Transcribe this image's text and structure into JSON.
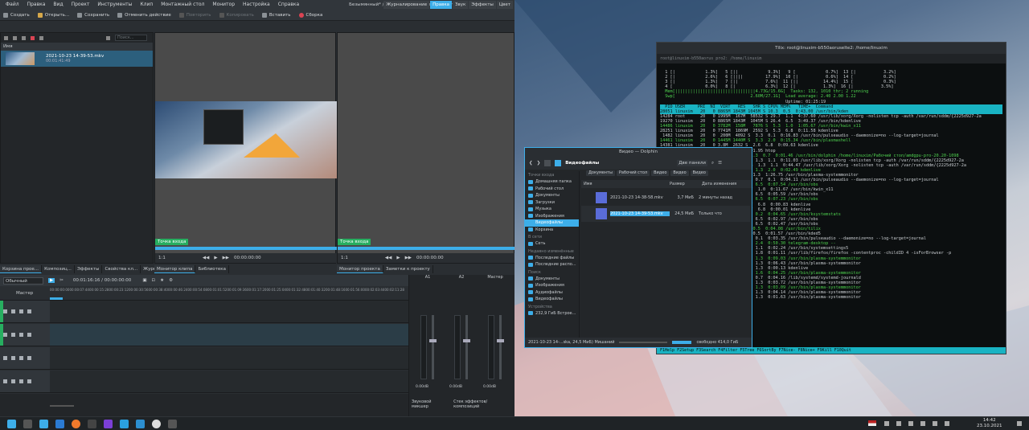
{
  "kdenlive": {
    "menu": [
      "Файл",
      "Правка",
      "Вид",
      "Проект",
      "Инструменты",
      "Клип",
      "Монтажный стол",
      "Монитор",
      "Настройка",
      "Справка"
    ],
    "title": "Безымянный* / 3440x1440 60.00fps — Kdenlive",
    "ws_tabs": [
      "Журналирование",
      "Правка",
      "Звук",
      "Эффекты",
      "Цвет"
    ],
    "toolbar": {
      "new": "Создать",
      "open": "Открыть...",
      "save": "Сохранить",
      "undo": "Отменить действие",
      "redo": "Повторить",
      "copy": "Копировать",
      "paste": "Вставить",
      "render": "Сборка"
    },
    "bin": {
      "column": "Имя",
      "search_placeholder": "Поиск...",
      "clip_name": "2021-10-23 14-39-53.mkv",
      "clip_dur": "00:01:41:49"
    },
    "dock_tabs_left": [
      "Корзина прое...",
      "Композиц...",
      "Эффекты",
      "Свойства кл...",
      "Журнал дейст..."
    ],
    "dock_tabs_clip": [
      "Монитор клипа",
      "Библиотека"
    ],
    "dock_tabs_proj": [
      "Монитор проекта",
      "Заметки к проекту"
    ],
    "clip_monitor": {
      "label": "Точка входа",
      "zoom": "1:1",
      "timecode": "00:00:00:00",
      "in_time": "00:00:00"
    },
    "proj_monitor": {
      "label": "Точка входа",
      "zoom": "1:1",
      "timecode": "00:00:00:00"
    },
    "timeline": {
      "mode": "Обычный режим",
      "timecode": "00:01:16:16 / 00:00:00:00",
      "master": "Мастер",
      "ruler": [
        "00:00:00:00",
        "00:00:07:44",
        "00:00:15:28",
        "00:00:23:12",
        "00:00:30:56",
        "00:00:38:40",
        "00:00:46:24",
        "00:00:54:08",
        "00:01:01:52",
        "00:01:09:36",
        "00:01:17:20",
        "00:01:25:04",
        "00:01:32:48",
        "00:01:40:32",
        "00:01:48:16",
        "00:01:56:00",
        "00:02:03:44",
        "00:02:11:28"
      ],
      "tracks": [
        "V2",
        "V1",
        "A1",
        "A2"
      ]
    },
    "mixer": {
      "channels": [
        "A1",
        "A2",
        "Мастер"
      ],
      "db": "0.00dB",
      "tabs": [
        "Звуковой микшер",
        "Стек эффектов/композиций"
      ]
    }
  },
  "konsole": {
    "title": "Tilix: root@linuxim-b550aorusel​te2: /home/linuxim",
    "tab": "root@linuxim-b550aorus pro2: /home/linuxim",
    "header": "  PID USER     PRI  NI  VIRT   RES   SHR S CPU% MEM%   TIME+  Command",
    "cpu_lines": [
      "  1 [|            1.3%]   5 [||            9.3%]   9 [            0.7%]  13 [|           3.2%]",
      "  2 [|            2.6%]   6 [||||         17.9%]  10 [|           0.6%]  14 [            0.2%]",
      "  3 [|            1.3%]   7 [||           7.6%]  11 [||          14.4%]  15 [            0.3%]",
      "  4 [             0.0%]   8 [|            6.3%]  12 [|           1.3%]  16 [|           3.5%]",
      "  Mem[||||||||||||||||||||||||||||||||4.73G/15.6G]  Tasks: 132, 1010 thr; 2 running",
      "  Swp[                              2.60M/27.1G]  Load average: 2.40 2.00 1.22",
      "                                                  Uptime: 01:25:19"
    ],
    "procs": [
      "28051 linuxim   20   0 8865M 1843M 1045M S 10.3  0.5  0:43.00 /usr/bin/kden",
      "14284 root      20   0 1995M  167M  58532 S 29.7  1.1  4:37.60 /usr/lib/xorg/Xorg -nolisten tcp -auth /var/run/sddm/{2225d927-2a",
      "19270 linuxim   20   0 8865M 1843M  1045M S 26.4  6.5  3:49.37 /usr/bin/kdenlive",
      "14486 linuxim   20   0 3782M  158M   7876 S  5.3  1.0  1:05.67 /usr/bin/kwin_x11",
      "28251 linuxim   20   0 7741M  1869M  2592 S  5.3  6.8  0:11.58 kdenlive",
      " 1482 linuxim   20   0  200M  4092 S  3.3  0.1  0:16.83 /usr/bin/pulseaudio --daemonize=no --log-target=journal",
      "14461 linuxim   20   0 1445M 1440M S  3.3  2.0  0:15.34 /usr/bin/plasmashell",
      "14381 linuxim   20   0 3.8M  2632 S  2.6  6.8  0:09.63 kdenlive",
      "14363 linuxim   20   0 104M  2.8  0:01.95 htop",
      "12833 linuxim   20   0 1.3M 2828 S  1.3  0.7  0:01.46 /usr/bin/dolphin /home/linuxim/Рабочий стол/amdgpu-pro-20.20-1098",
      "14281 root      20   0  140M  8532 S  1.3  1.1  0:11.03 /usr/lib/xorg/Xorg -nolisten tcp -auth /var/run/sddm/{2225d927-2a",
      "14467 root      20   0  1955M  8532 S  1.3  1.1  0:44.47 /usr/lib/xorg/Xorg -nolisten tcp -auth /var/run/sddm/{2225d927-2a",
      "14470 linuxim   20   0  148M  4092 S  1.3  2.0  0:02.49 kdenlive",
      "14352 linuxim   20   0  1.3M  5 0.7  1.3  1:26.75 /usr/bin/plasma-systemmonitor",
      "14353 linuxim   20   0  200M  4092 S  0.7  0.1  0:04.11 /usr/bin/pulseaudio --daemonize=no --log-target=journal",
      "14318 linuxim   20   0  128M  S  0.7  6.5  0:07.54 /usr/bin/obs",
      "14313 linuxim   20   0  3782M  S  0.7  1.0  0:11.67 /usr/bin/kwin_x11",
      "14317 linuxim   20   0  153M  S  0.7  6.5  0:05.59 /usr/bin/obs",
      "14339 linuxim   20   0  153M  S  0.7  6.5  0:07.23 /usr/bin/obs",
      "14386 linuxim   20   0  7741M  S  0.7  6.8  0:00.83 kdenlive",
      "14396 linuxim   20   0  7741M  S  0.7  6.8  0:00.01 kdenlive",
      "14385 linuxim   20   0  700M  S  0.7  0.2  0:04.65 /usr/bin/ksystemstats",
      "14383 linuxim   20   0  153M  S  0.7  6.5  0:02.97 /usr/bin/obs",
      "14397 linuxim   20   0  153M  S  0.7  6.5  0:02.47 /usr/bin/obs",
      "14486 linuxim   20   0 276M  S  0.7  0.5  0:04.08 /usr/bin/tilix",
      "14497 linuxim   20   0 172M  S  0.7  0.5  0:01.57 /usr/bin/kded5",
      "14503 linuxim   20   0  200M  S  0.0  0.1  0:03.35 /usr/bin/pulseaudio --daemonize=no --log-target=journal",
      "14495 linuxim   20   0 1375M  S  0.0  2.4  0:50.30 telegram-desktop --",
      "14556 linuxim   20   0  117M  S  0.0  1.1  0:02.24 /usr/bin/systemsettings5",
      "14557 linuxim   20   0  227M  S  0.0  1.8  0:01.11 /usr/lib/firefox/firefox -contentproc -childID 4 -isForBrowser -p",
      "14558 linuxim   20   0  110M  S  0.0  1.3  0:09.03 /usr/bin/plasma-systemmonitor",
      "14559 linuxim   20   0  110M  S  0.0  1.3  0:06.43 /usr/bin/plasma-systemmonitor",
      "14560 linuxim   20   0  110M  S  0.0  1.3  0:00.13 kdenlive",
      "14561 linuxim   20   0  110M  S  0.0  1.6  0:04.25 /usr/bin/plasma-systemmonitor",
      "14562 root      20   0  110M  S  0.0  0.7  0:04.16 /lib/systemd/systemd-journald",
      "14563 linuxim   20   0  110M  S  0.0  1.3  0:03.72 /usr/bin/plasma-systemmonitor",
      "14564 linuxim   20   0  110M  S  0.0  1.3  0:03.09 /usr/bin/plasma-systemmonitor",
      "14565 linuxim   20   0  110M  S  0.0  1.3  0:04.14 /usr/bin/plasma-systemmonitor",
      "14566 linuxim   20   0  110M  S  0.0  1.3  0:01.63 /usr/bin/plasma-systemmonitor"
    ],
    "fkeys": "F1Help F2Setup F3Search F4Filter F5Tree F6SortBy F7Nice- F8Nice+ F9Kill F10Quit"
  },
  "dolphin": {
    "title": "Видео — Dolphin",
    "location": "Видеофайлы",
    "panel_btn": "Две панели",
    "breadcrumbs": [
      "Документы",
      "Рабочий стол",
      "Видео",
      "Видео",
      "Видео"
    ],
    "places_head": "Точки входа",
    "places": [
      "Домашняя папка",
      "Рабочий стол",
      "Документы",
      "Загрузки",
      "Музыка",
      "Изображения",
      "Видеофайлы",
      "Корзина"
    ],
    "net_head": "В сети",
    "net": [
      "Сеть"
    ],
    "recent_head": "Недавно изменённые",
    "recent": [
      "Последние файлы",
      "Последние распо..."
    ],
    "search_head": "Поиск",
    "search": [
      "Документы",
      "Изображения",
      "Аудиофайлы",
      "Видеофайлы"
    ],
    "dev_head": "Устройства",
    "devices": [
      "232,9 ГиБ Встрое..."
    ],
    "cols": [
      "Имя",
      "Размер",
      "Дата изменения"
    ],
    "files": [
      {
        "name": "2021-10-23 14-38-58.mkv",
        "size": "3,7 МиБ",
        "date": "2 минуты назад"
      },
      {
        "name": "2021-10-23 14-39-53.mkv",
        "size": "24,5 МиБ",
        "date": "Только что"
      }
    ],
    "status": "2021-10-23 14-...ska, 24,5 МиБ) Мишаний",
    "free": "свободно 414,0 ГиБ"
  },
  "taskbar": {
    "time": "14:42",
    "date": "23.10.2021"
  },
  "colors": {
    "accent": "#3daee9",
    "track_green": "#27ae60"
  }
}
